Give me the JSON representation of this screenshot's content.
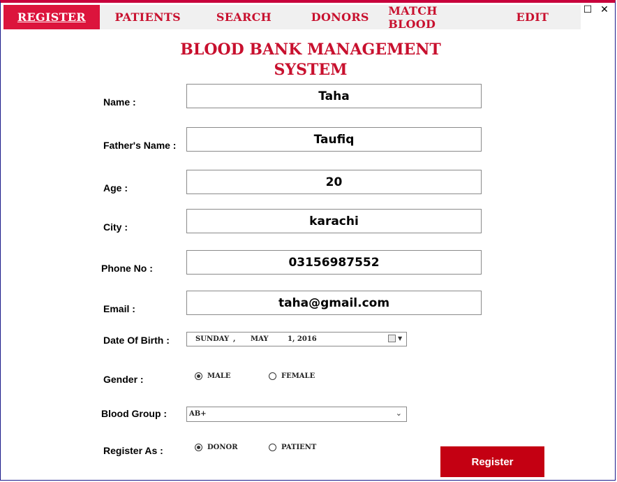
{
  "tabs": [
    {
      "label": "REGISTER"
    },
    {
      "label": "PATIENTS"
    },
    {
      "label": "SEARCH"
    },
    {
      "label": "DONORS"
    },
    {
      "label": "MATCH BLOOD"
    },
    {
      "label": "EDIT"
    }
  ],
  "window_controls": {
    "maximize": "☐",
    "close": "✕"
  },
  "title": {
    "line1": "BLOOD BANK MANAGEMENT",
    "line2": "SYSTEM"
  },
  "form": {
    "name": {
      "label": "Name :",
      "value": "Taha"
    },
    "father": {
      "label": "Father's Name :",
      "value": "Taufiq"
    },
    "age": {
      "label": "Age :",
      "value": "20"
    },
    "city": {
      "label": "City :",
      "value": "karachi"
    },
    "phone": {
      "label": "Phone No :",
      "value": "03156987552"
    },
    "email": {
      "label": "Email :",
      "value": "taha@gmail.com"
    },
    "dob": {
      "label": "Date Of Birth :",
      "day": "SUNDAY",
      "sep": ",",
      "month": "MAY",
      "date": "1, 2016"
    },
    "gender": {
      "label": "Gender :",
      "options": [
        "MALE",
        "FEMALE"
      ],
      "selected": "MALE"
    },
    "blood_group": {
      "label": "Blood Group :",
      "value": "AB+"
    },
    "register_as": {
      "label": "Register As :",
      "options": [
        "DONOR",
        "PATIENT"
      ],
      "selected": "DONOR"
    }
  },
  "register_button": "Register",
  "colors": {
    "accent": "#dc143c",
    "brand_red": "#c8102e",
    "button": "#c40012",
    "tabbar_bg": "#f0f0f0"
  },
  "icons": {
    "calendar": "calendar-icon",
    "dropdown": "chevron-down-icon"
  }
}
